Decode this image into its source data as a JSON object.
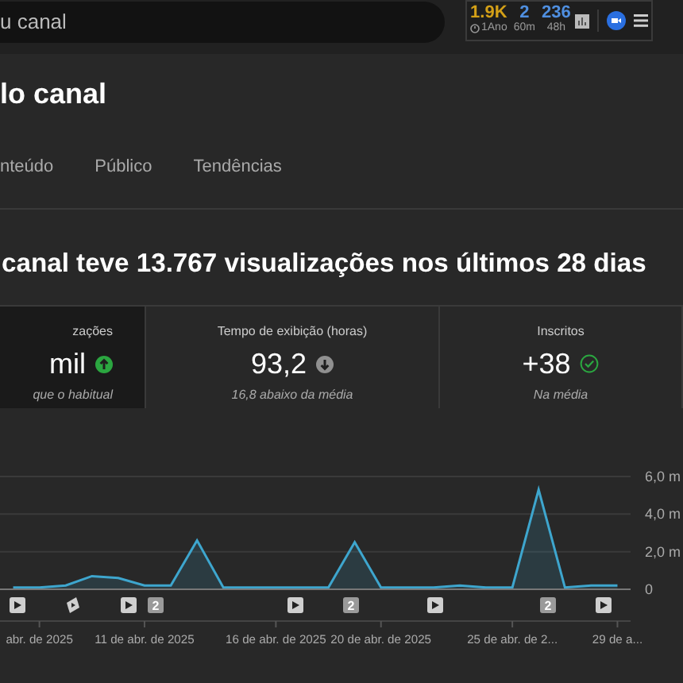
{
  "search": {
    "value": "u canal"
  },
  "stats_widget": {
    "items": [
      {
        "value": "1.9K",
        "caption": "1Ano",
        "color": "#d4a017",
        "clock": true
      },
      {
        "value": "2",
        "caption": "60m",
        "color": "#4f8fe0",
        "clock": false
      },
      {
        "value": "236",
        "caption": "48h",
        "color": "#4f8fe0",
        "clock": false
      }
    ]
  },
  "page_title": "lo canal",
  "tabs": [
    {
      "label": "nteúdo",
      "selected": false
    },
    {
      "label": "Público",
      "selected": false
    },
    {
      "label": "Tendências",
      "selected": false
    }
  ],
  "headline": "canal teve 13.767 visualizações nos últimos 28 dias",
  "cards": [
    {
      "title": "zações",
      "value": "mil",
      "kind": "up",
      "note": "que o habitual",
      "selected": true
    },
    {
      "title": "Tempo de exibição (horas)",
      "value": "93,2",
      "kind": "down",
      "note": "16,8 abaixo da média",
      "selected": false
    },
    {
      "title": "Inscritos",
      "value": "+38",
      "kind": "check",
      "note": "Na média",
      "selected": false
    }
  ],
  "chart_data": {
    "type": "area",
    "categories": [
      null,
      "abr. de 2025",
      null,
      null,
      null,
      "11 de abr. de 2025",
      null,
      null,
      null,
      null,
      "16 de abr. de 2025",
      null,
      null,
      null,
      "20 de abr. de 2025",
      null,
      null,
      null,
      null,
      "25 de abr. de 2...",
      null,
      null,
      null,
      "29 de a..."
    ],
    "series": [
      {
        "color": "#3ea6ce",
        "values": [
          0.1,
          0.1,
          0.2,
          0.7,
          0.6,
          0.2,
          0.2,
          2.6,
          0.1,
          0.1,
          0.1,
          0.1,
          0.1,
          2.5,
          0.1,
          0.1,
          0.1,
          0.2,
          0.1,
          0.1,
          5.3,
          0.1,
          0.2,
          0.2
        ]
      }
    ],
    "ylim": [
      0,
      6
    ],
    "yticks": [
      {
        "value": 6,
        "label": "6,0 m"
      },
      {
        "value": 4,
        "label": "4,0 m"
      },
      {
        "value": 2,
        "label": "2,0 m"
      },
      {
        "value": 0,
        "label": "0"
      }
    ]
  },
  "upload_markers": [
    {
      "kind": "video"
    },
    {
      "kind": "short"
    },
    {
      "kind": "video"
    },
    {
      "kind": "count",
      "text": "2"
    },
    {
      "kind": "video"
    },
    {
      "kind": "count",
      "text": "2"
    },
    {
      "kind": "video"
    },
    {
      "kind": "count",
      "text": "2"
    },
    {
      "kind": "video"
    }
  ]
}
